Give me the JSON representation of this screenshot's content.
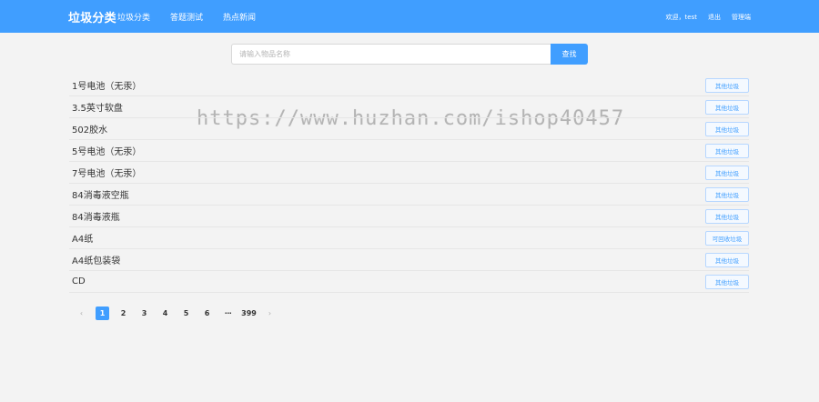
{
  "header": {
    "brand": "垃圾分类",
    "nav": [
      "垃圾分类",
      "答题测试",
      "热点新闻"
    ],
    "user": "欢迎，test",
    "logout": "退出",
    "admin": "管理端"
  },
  "search": {
    "placeholder": "请输入物品名称",
    "button": "查找"
  },
  "watermark": "https://www.huzhan.com/ishop40457",
  "items": [
    {
      "name": "1号电池（无汞）",
      "tag": "其他垃圾"
    },
    {
      "name": "3.5英寸软盘",
      "tag": "其他垃圾"
    },
    {
      "name": "502胶水",
      "tag": "其他垃圾"
    },
    {
      "name": "5号电池（无汞）",
      "tag": "其他垃圾"
    },
    {
      "name": "7号电池（无汞）",
      "tag": "其他垃圾"
    },
    {
      "name": "84消毒液空瓶",
      "tag": "其他垃圾"
    },
    {
      "name": "84消毒液瓶",
      "tag": "其他垃圾"
    },
    {
      "name": "A4纸",
      "tag": "可回收垃圾"
    },
    {
      "name": "A4纸包装袋",
      "tag": "其他垃圾"
    },
    {
      "name": "CD",
      "tag": "其他垃圾"
    }
  ],
  "pagination": {
    "prev": "‹",
    "pages": [
      "1",
      "2",
      "3",
      "4",
      "5",
      "6"
    ],
    "ellipsis": "···",
    "last": "399",
    "next": "›"
  },
  "colors": {
    "primary": "#409eff",
    "background": "#f3f3f3"
  }
}
